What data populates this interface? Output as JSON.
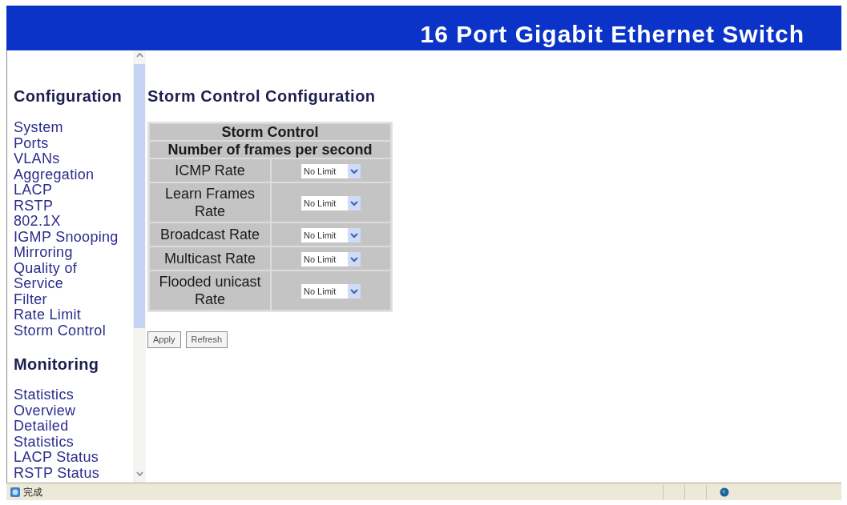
{
  "header": {
    "title": "16 Port Gigabit Ethernet Switch"
  },
  "sidebar": {
    "sections": [
      {
        "heading": "Configuration",
        "items": [
          {
            "label": "System"
          },
          {
            "label": "Ports"
          },
          {
            "label": "VLANs"
          },
          {
            "label": "Aggregation"
          },
          {
            "label": "LACP"
          },
          {
            "label": "RSTP"
          },
          {
            "label": "802.1X"
          },
          {
            "label": "IGMP Snooping"
          },
          {
            "label": "Mirroring"
          },
          {
            "label": "Quality of Service"
          },
          {
            "label": "Filter"
          },
          {
            "label": "Rate Limit"
          },
          {
            "label": "Storm Control"
          }
        ]
      },
      {
        "heading": "Monitoring",
        "items": [
          {
            "label": "Statistics Overview"
          },
          {
            "label": "Detailed Statistics"
          },
          {
            "label": "LACP Status"
          },
          {
            "label": "RSTP Status"
          }
        ]
      }
    ]
  },
  "main": {
    "title": "Storm Control Configuration",
    "table": {
      "header": [
        "Storm Control",
        "Number of frames per second"
      ],
      "rows": [
        {
          "label": "ICMP Rate",
          "value": "No Limit"
        },
        {
          "label": "Learn Frames Rate",
          "value": "No Limit"
        },
        {
          "label": "Broadcast Rate",
          "value": "No Limit"
        },
        {
          "label": "Multicast Rate",
          "value": "No Limit"
        },
        {
          "label": "Flooded unicast Rate",
          "value": "No Limit"
        }
      ]
    },
    "buttons": [
      "Apply",
      "Refresh"
    ]
  },
  "status_bar": {
    "text": "完成"
  }
}
